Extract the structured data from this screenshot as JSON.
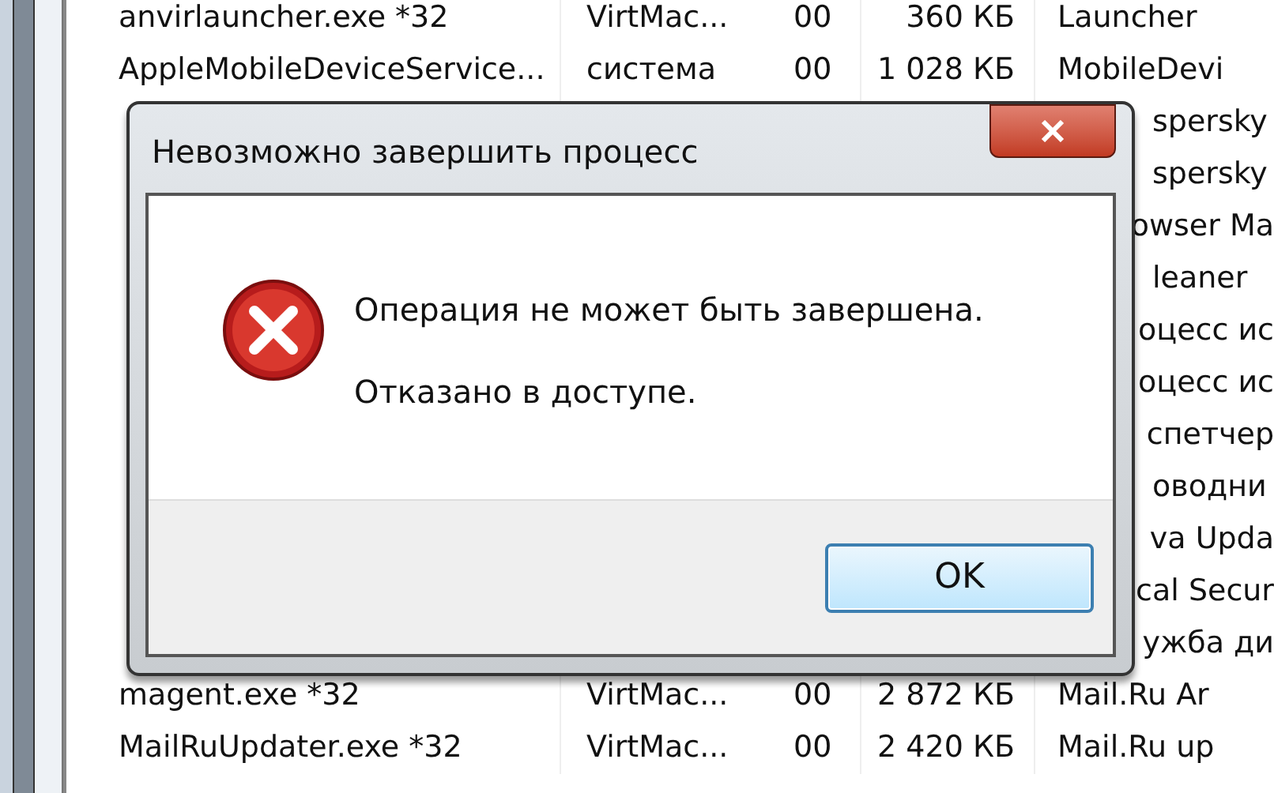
{
  "process_table": {
    "rows": [
      {
        "name": "anvirlauncher.exe *32",
        "user": "VirtMac...",
        "cpu": "00",
        "memory": "360 КБ",
        "description": "Launcher"
      },
      {
        "name": "AppleMobileDeviceService...",
        "user": "система",
        "cpu": "00",
        "memory": "1 028 КБ",
        "description": "MobileDevi"
      },
      {
        "description": "spersky"
      },
      {
        "description": "spersky"
      },
      {
        "description": "owser Ma"
      },
      {
        "description": "leaner"
      },
      {
        "description": "оцесс ис"
      },
      {
        "description": "оцесс ис"
      },
      {
        "description": "спетчер"
      },
      {
        "description": "оводни"
      },
      {
        "description": "va Upda"
      },
      {
        "description": "cal Secur"
      },
      {
        "description": "ужба ди"
      },
      {
        "name": "magent.exe *32",
        "user": "VirtMac...",
        "cpu": "00",
        "memory": "2 872 КБ",
        "description": "Mail.Ru Ar"
      },
      {
        "name": "MailRuUpdater.exe *32",
        "user": "VirtMac...",
        "cpu": "00",
        "memory": "2 420 КБ",
        "description": "Mail.Ru up"
      }
    ]
  },
  "dialog": {
    "title": "Невозможно завершить процесс",
    "messages": [
      "Операция не может быть завершена.",
      "Отказано в доступе."
    ],
    "buttons": [
      "OK"
    ]
  }
}
